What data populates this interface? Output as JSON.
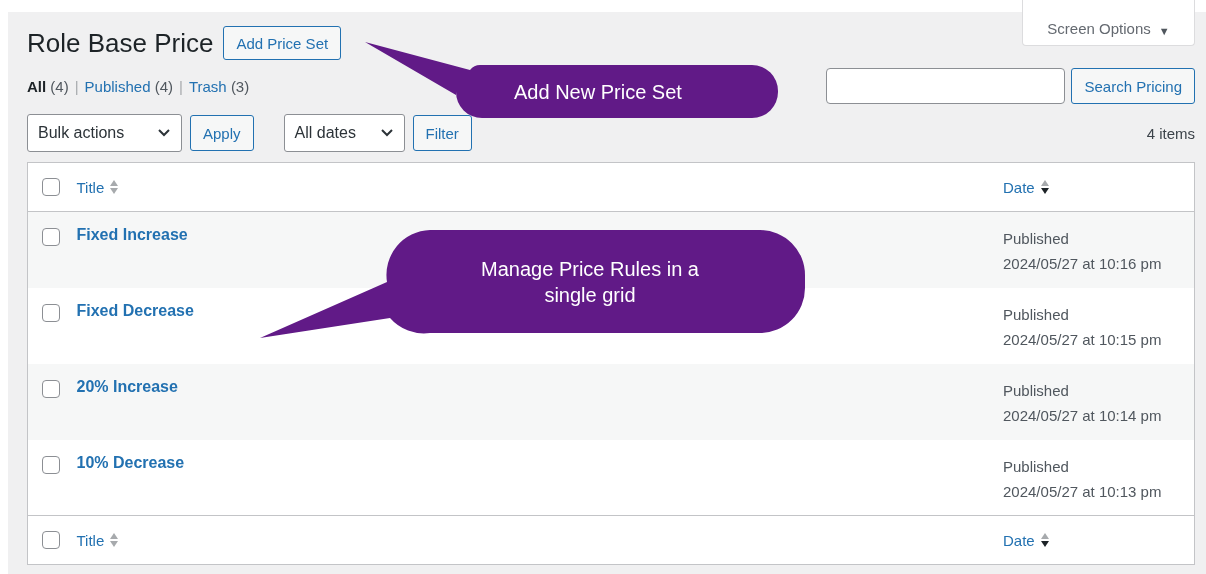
{
  "screen_options": {
    "label": "Screen Options",
    "caret": "▼"
  },
  "heading": {
    "title": "Role Base Price",
    "add_button": "Add Price Set"
  },
  "views": [
    {
      "label": "All",
      "count": "(4)",
      "selected": true
    },
    {
      "separator": "|",
      "label": "Published",
      "count": "(4)",
      "selected": false
    },
    {
      "separator": "|",
      "label": "Trash",
      "count": "(3)",
      "selected": false
    }
  ],
  "search": {
    "button": "Search Pricing"
  },
  "toolbar": {
    "bulk_select": "Bulk actions",
    "apply": "Apply",
    "date_select": "All dates",
    "filter": "Filter",
    "item_count": "4 items"
  },
  "table": {
    "header": {
      "checked": false,
      "columns": [
        {
          "label": "Title",
          "sorted": false
        },
        {
          "label": "Date",
          "sorted": true
        }
      ]
    },
    "rows": [
      {
        "title": "Fixed Increase",
        "status": "Published",
        "date": "2024/05/27 at 10:16 pm",
        "checked": false
      },
      {
        "title": "Fixed Decrease",
        "status": "Published",
        "date": "2024/05/27 at 10:15 pm",
        "checked": false
      },
      {
        "title": "20% Increase",
        "status": "Published",
        "date": "2024/05/27 at 10:14 pm",
        "checked": false
      },
      {
        "title": "10% Decrease",
        "status": "Published",
        "date": "2024/05/27 at 10:13 pm",
        "checked": false
      }
    ],
    "footer": {
      "checked": false,
      "columns": [
        {
          "label": "Title",
          "sorted": false
        },
        {
          "label": "Date",
          "sorted": true
        }
      ]
    }
  },
  "callouts": [
    {
      "text": "Add New Price Set"
    },
    {
      "text": "Manage Price Rules in a single grid"
    }
  ]
}
